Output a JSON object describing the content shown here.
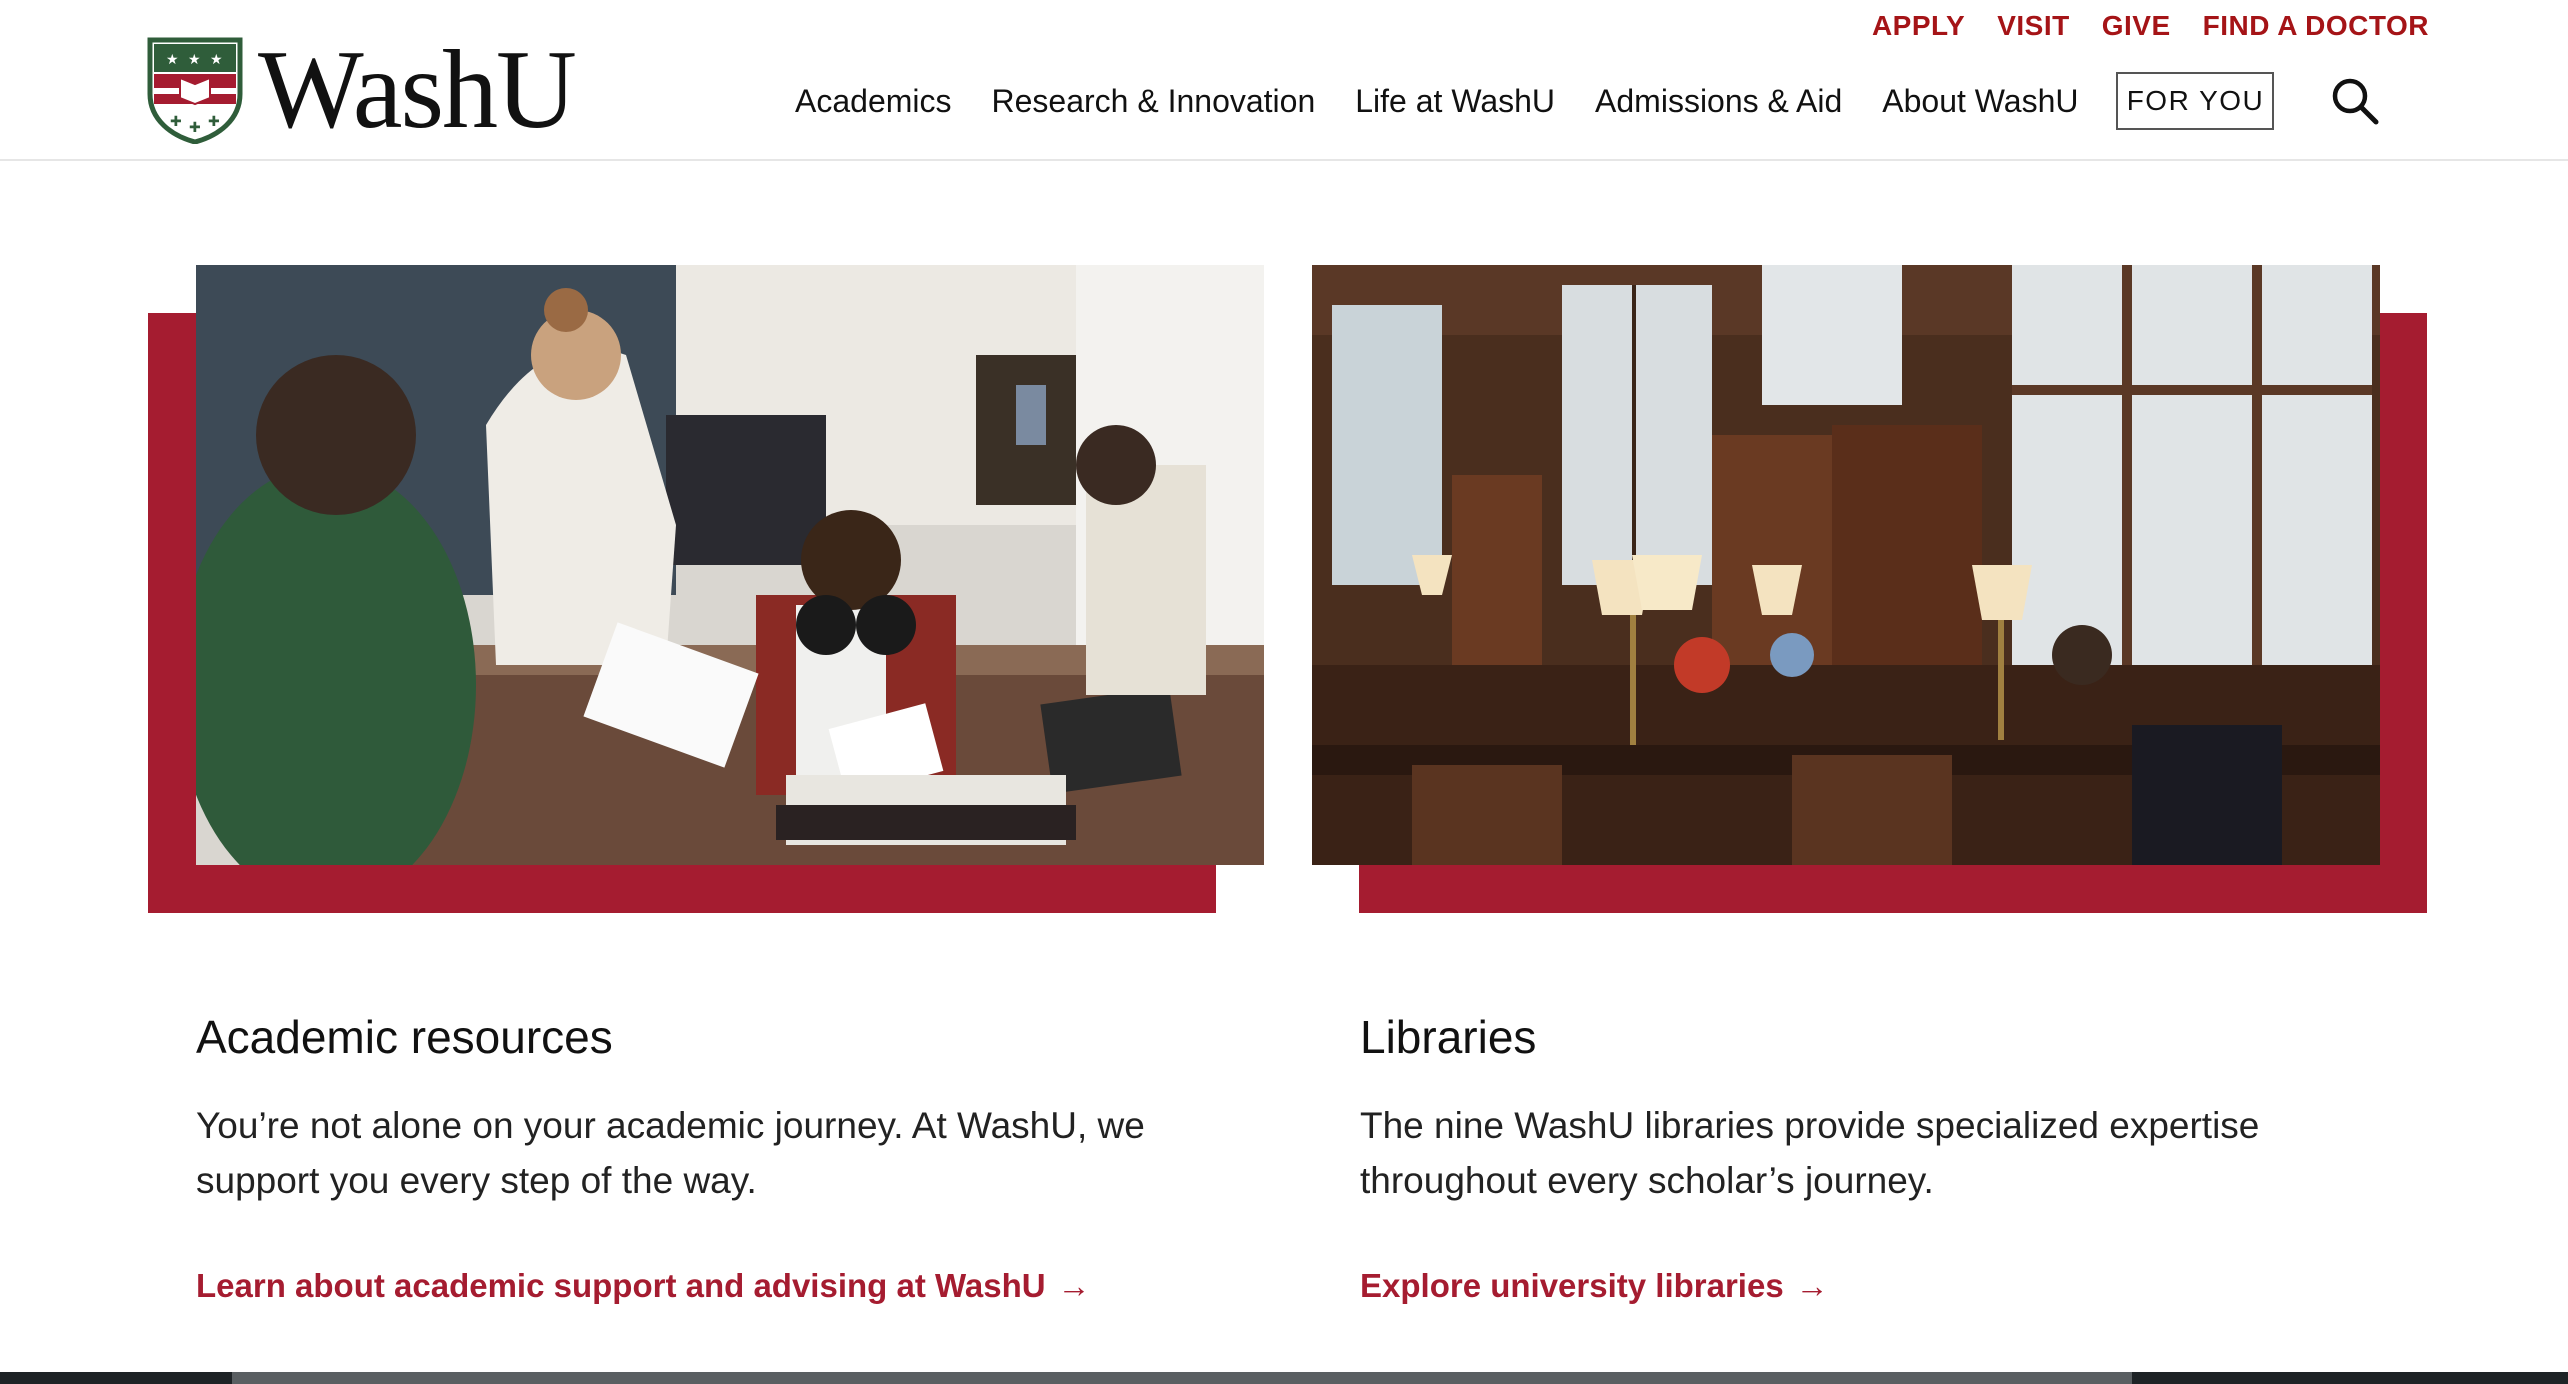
{
  "header": {
    "logo_text": "WashU",
    "utility_links": [
      "APPLY",
      "VISIT",
      "GIVE",
      "FIND A DOCTOR"
    ],
    "nav_items": [
      "Academics",
      "Research & Innovation",
      "Life at WashU",
      "Admissions & Aid",
      "About WashU"
    ],
    "for_you_label": "FOR YOU"
  },
  "cards": [
    {
      "title": "Academic resources",
      "description": "You’re not alone on your academic journey. At WashU, we support you every step of the way.",
      "link_text": "Learn about academic support and advising at WashU",
      "arrow": "→"
    },
    {
      "title": "Libraries",
      "description": "The nine WashU libraries provide specialized expertise throughout every scholar’s journey.",
      "link_text": "Explore university libraries",
      "arrow": "→"
    }
  ],
  "colors": {
    "brand_red": "#a51c30",
    "utility_red": "#a51417",
    "text": "#111111"
  },
  "icons": {
    "logo": "washu-shield-icon",
    "search": "search-icon",
    "link_arrow": "arrow-right-icon"
  }
}
